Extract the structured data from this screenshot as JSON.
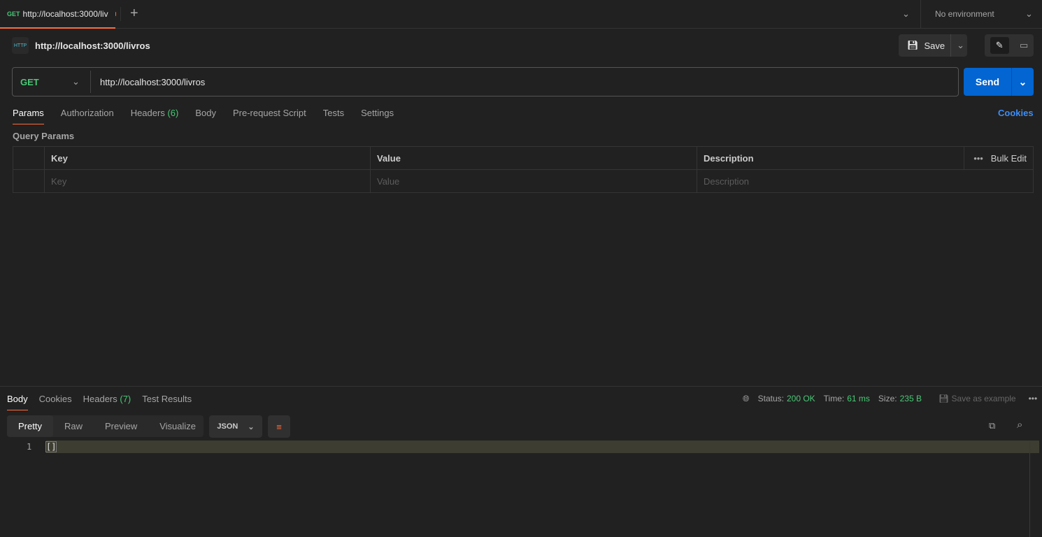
{
  "tab": {
    "method": "GET",
    "title": "http://localhost:3000/liv",
    "add": "+"
  },
  "environment": "No environment",
  "request": {
    "name": "http://localhost:3000/livros",
    "method": "GET",
    "url": "http://localhost:3000/livros",
    "save": "Save",
    "send": "Send"
  },
  "req_tabs": [
    {
      "label": "Params"
    },
    {
      "label": "Authorization"
    },
    {
      "label": "Headers",
      "count": "(6)"
    },
    {
      "label": "Body"
    },
    {
      "label": "Pre-request Script"
    },
    {
      "label": "Tests"
    },
    {
      "label": "Settings"
    }
  ],
  "cookies": "Cookies",
  "query_params": {
    "title": "Query Params",
    "headers": [
      "Key",
      "Value",
      "Description"
    ],
    "bulk_edit": "Bulk Edit",
    "placeholders": [
      "Key",
      "Value",
      "Description"
    ]
  },
  "response": {
    "tabs": [
      {
        "label": "Body"
      },
      {
        "label": "Cookies"
      },
      {
        "label": "Headers",
        "count": "(7)"
      },
      {
        "label": "Test Results"
      }
    ],
    "status_label": "Status:",
    "status": "200 OK",
    "time_label": "Time:",
    "time": "61 ms",
    "size_label": "Size:",
    "size": "235 B",
    "save_example": "Save as example",
    "views": [
      "Pretty",
      "Raw",
      "Preview",
      "Visualize"
    ],
    "format": "JSON",
    "lines": [
      {
        "n": "1",
        "text": "[]"
      }
    ]
  },
  "colors": {
    "accent": "#ff6c37",
    "send": "#0265d2",
    "green": "#49c876"
  }
}
